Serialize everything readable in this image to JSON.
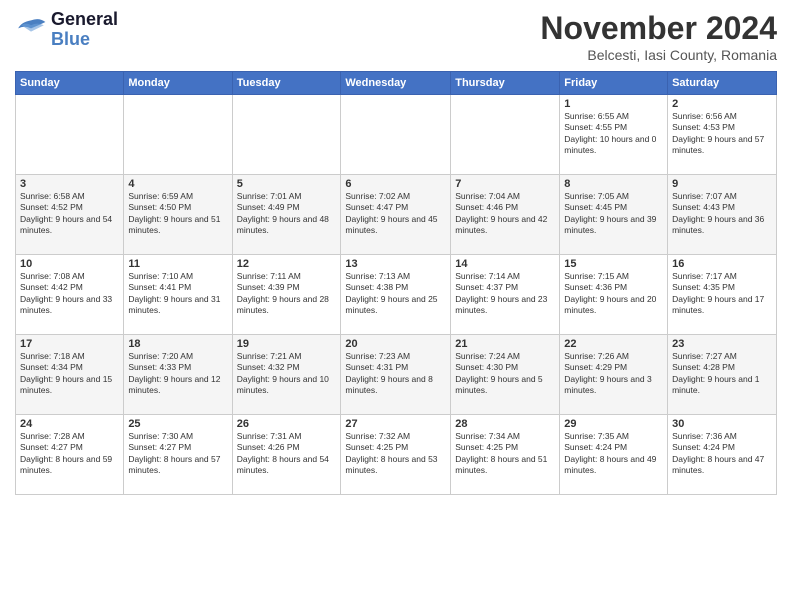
{
  "header": {
    "logo_general": "General",
    "logo_blue": "Blue",
    "title": "November 2024",
    "subtitle": "Belcesti, Iasi County, Romania"
  },
  "weekdays": [
    "Sunday",
    "Monday",
    "Tuesday",
    "Wednesday",
    "Thursday",
    "Friday",
    "Saturday"
  ],
  "weeks": [
    [
      {
        "day": "",
        "sunrise": "",
        "sunset": "",
        "daylight": ""
      },
      {
        "day": "",
        "sunrise": "",
        "sunset": "",
        "daylight": ""
      },
      {
        "day": "",
        "sunrise": "",
        "sunset": "",
        "daylight": ""
      },
      {
        "day": "",
        "sunrise": "",
        "sunset": "",
        "daylight": ""
      },
      {
        "day": "",
        "sunrise": "",
        "sunset": "",
        "daylight": ""
      },
      {
        "day": "1",
        "sunrise": "Sunrise: 6:55 AM",
        "sunset": "Sunset: 4:55 PM",
        "daylight": "Daylight: 10 hours and 0 minutes."
      },
      {
        "day": "2",
        "sunrise": "Sunrise: 6:56 AM",
        "sunset": "Sunset: 4:53 PM",
        "daylight": "Daylight: 9 hours and 57 minutes."
      }
    ],
    [
      {
        "day": "3",
        "sunrise": "Sunrise: 6:58 AM",
        "sunset": "Sunset: 4:52 PM",
        "daylight": "Daylight: 9 hours and 54 minutes."
      },
      {
        "day": "4",
        "sunrise": "Sunrise: 6:59 AM",
        "sunset": "Sunset: 4:50 PM",
        "daylight": "Daylight: 9 hours and 51 minutes."
      },
      {
        "day": "5",
        "sunrise": "Sunrise: 7:01 AM",
        "sunset": "Sunset: 4:49 PM",
        "daylight": "Daylight: 9 hours and 48 minutes."
      },
      {
        "day": "6",
        "sunrise": "Sunrise: 7:02 AM",
        "sunset": "Sunset: 4:47 PM",
        "daylight": "Daylight: 9 hours and 45 minutes."
      },
      {
        "day": "7",
        "sunrise": "Sunrise: 7:04 AM",
        "sunset": "Sunset: 4:46 PM",
        "daylight": "Daylight: 9 hours and 42 minutes."
      },
      {
        "day": "8",
        "sunrise": "Sunrise: 7:05 AM",
        "sunset": "Sunset: 4:45 PM",
        "daylight": "Daylight: 9 hours and 39 minutes."
      },
      {
        "day": "9",
        "sunrise": "Sunrise: 7:07 AM",
        "sunset": "Sunset: 4:43 PM",
        "daylight": "Daylight: 9 hours and 36 minutes."
      }
    ],
    [
      {
        "day": "10",
        "sunrise": "Sunrise: 7:08 AM",
        "sunset": "Sunset: 4:42 PM",
        "daylight": "Daylight: 9 hours and 33 minutes."
      },
      {
        "day": "11",
        "sunrise": "Sunrise: 7:10 AM",
        "sunset": "Sunset: 4:41 PM",
        "daylight": "Daylight: 9 hours and 31 minutes."
      },
      {
        "day": "12",
        "sunrise": "Sunrise: 7:11 AM",
        "sunset": "Sunset: 4:39 PM",
        "daylight": "Daylight: 9 hours and 28 minutes."
      },
      {
        "day": "13",
        "sunrise": "Sunrise: 7:13 AM",
        "sunset": "Sunset: 4:38 PM",
        "daylight": "Daylight: 9 hours and 25 minutes."
      },
      {
        "day": "14",
        "sunrise": "Sunrise: 7:14 AM",
        "sunset": "Sunset: 4:37 PM",
        "daylight": "Daylight: 9 hours and 23 minutes."
      },
      {
        "day": "15",
        "sunrise": "Sunrise: 7:15 AM",
        "sunset": "Sunset: 4:36 PM",
        "daylight": "Daylight: 9 hours and 20 minutes."
      },
      {
        "day": "16",
        "sunrise": "Sunrise: 7:17 AM",
        "sunset": "Sunset: 4:35 PM",
        "daylight": "Daylight: 9 hours and 17 minutes."
      }
    ],
    [
      {
        "day": "17",
        "sunrise": "Sunrise: 7:18 AM",
        "sunset": "Sunset: 4:34 PM",
        "daylight": "Daylight: 9 hours and 15 minutes."
      },
      {
        "day": "18",
        "sunrise": "Sunrise: 7:20 AM",
        "sunset": "Sunset: 4:33 PM",
        "daylight": "Daylight: 9 hours and 12 minutes."
      },
      {
        "day": "19",
        "sunrise": "Sunrise: 7:21 AM",
        "sunset": "Sunset: 4:32 PM",
        "daylight": "Daylight: 9 hours and 10 minutes."
      },
      {
        "day": "20",
        "sunrise": "Sunrise: 7:23 AM",
        "sunset": "Sunset: 4:31 PM",
        "daylight": "Daylight: 9 hours and 8 minutes."
      },
      {
        "day": "21",
        "sunrise": "Sunrise: 7:24 AM",
        "sunset": "Sunset: 4:30 PM",
        "daylight": "Daylight: 9 hours and 5 minutes."
      },
      {
        "day": "22",
        "sunrise": "Sunrise: 7:26 AM",
        "sunset": "Sunset: 4:29 PM",
        "daylight": "Daylight: 9 hours and 3 minutes."
      },
      {
        "day": "23",
        "sunrise": "Sunrise: 7:27 AM",
        "sunset": "Sunset: 4:28 PM",
        "daylight": "Daylight: 9 hours and 1 minute."
      }
    ],
    [
      {
        "day": "24",
        "sunrise": "Sunrise: 7:28 AM",
        "sunset": "Sunset: 4:27 PM",
        "daylight": "Daylight: 8 hours and 59 minutes."
      },
      {
        "day": "25",
        "sunrise": "Sunrise: 7:30 AM",
        "sunset": "Sunset: 4:27 PM",
        "daylight": "Daylight: 8 hours and 57 minutes."
      },
      {
        "day": "26",
        "sunrise": "Sunrise: 7:31 AM",
        "sunset": "Sunset: 4:26 PM",
        "daylight": "Daylight: 8 hours and 54 minutes."
      },
      {
        "day": "27",
        "sunrise": "Sunrise: 7:32 AM",
        "sunset": "Sunset: 4:25 PM",
        "daylight": "Daylight: 8 hours and 53 minutes."
      },
      {
        "day": "28",
        "sunrise": "Sunrise: 7:34 AM",
        "sunset": "Sunset: 4:25 PM",
        "daylight": "Daylight: 8 hours and 51 minutes."
      },
      {
        "day": "29",
        "sunrise": "Sunrise: 7:35 AM",
        "sunset": "Sunset: 4:24 PM",
        "daylight": "Daylight: 8 hours and 49 minutes."
      },
      {
        "day": "30",
        "sunrise": "Sunrise: 7:36 AM",
        "sunset": "Sunset: 4:24 PM",
        "daylight": "Daylight: 8 hours and 47 minutes."
      }
    ]
  ]
}
